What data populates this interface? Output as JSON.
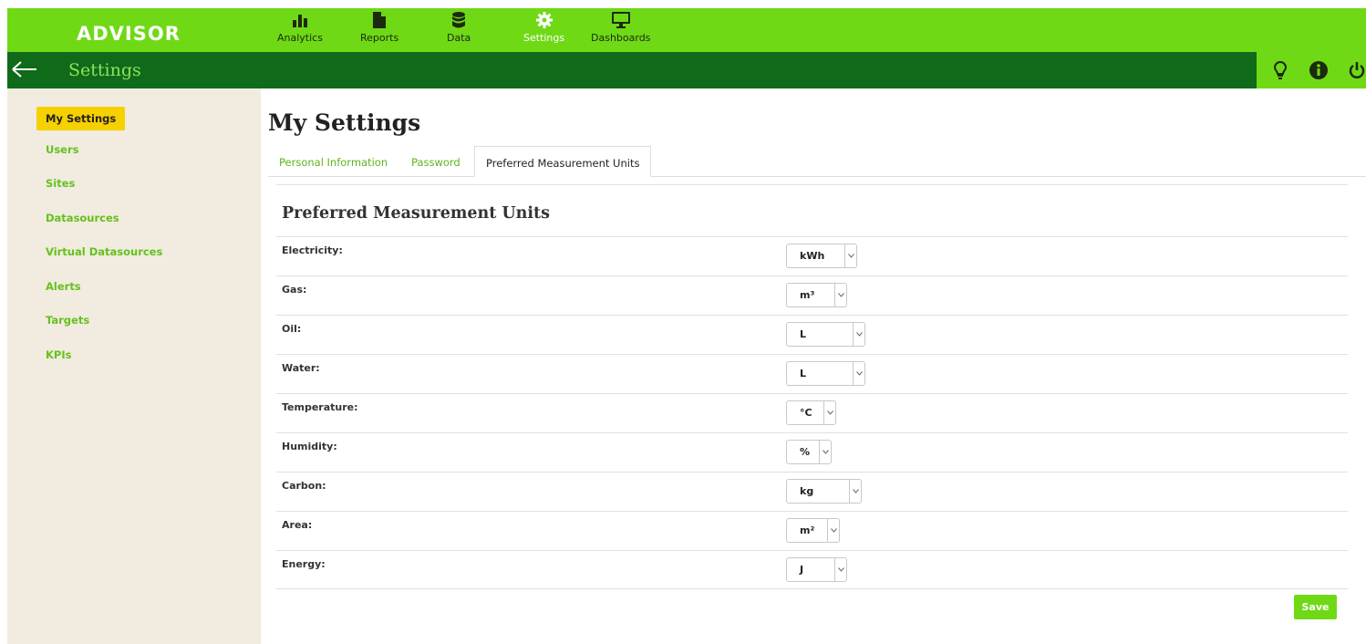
{
  "app": {
    "logo": "ADVISOR"
  },
  "nav": [
    {
      "label": "Analytics",
      "icon": "bar-chart-icon"
    },
    {
      "label": "Reports",
      "icon": "document-icon"
    },
    {
      "label": "Data",
      "icon": "database-icon"
    },
    {
      "label": "Settings",
      "icon": "gear-icon",
      "active": true
    },
    {
      "label": "Dashboards",
      "icon": "monitor-icon"
    }
  ],
  "subbar": {
    "title": "Settings"
  },
  "sidebar": {
    "items": [
      {
        "label": "My Settings",
        "active": true
      },
      {
        "label": "Users"
      },
      {
        "label": "Sites"
      },
      {
        "label": "Datasources"
      },
      {
        "label": "Virtual Datasources"
      },
      {
        "label": "Alerts"
      },
      {
        "label": "Targets"
      },
      {
        "label": "KPIs"
      }
    ]
  },
  "main": {
    "title": "My Settings",
    "tabs": [
      {
        "label": "Personal Information"
      },
      {
        "label": "Password"
      },
      {
        "label": "Preferred Measurement Units",
        "active": true
      }
    ],
    "section_title": "Preferred Measurement Units",
    "units": [
      {
        "label": "Electricity:",
        "value": "kWh"
      },
      {
        "label": "Gas:",
        "value": "m³"
      },
      {
        "label": "Oil:",
        "value": "L"
      },
      {
        "label": "Water:",
        "value": "L"
      },
      {
        "label": "Temperature:",
        "value": "°C"
      },
      {
        "label": "Humidity:",
        "value": "%"
      },
      {
        "label": "Carbon:",
        "value": "kg"
      },
      {
        "label": "Area:",
        "value": "m²"
      },
      {
        "label": "Energy:",
        "value": "J"
      }
    ],
    "save_label": "Save"
  },
  "colors": {
    "accent": "#6fd916",
    "dark": "#0f6b1a",
    "highlight": "#f7d000",
    "sidebar_bg": "#f1ebe0"
  }
}
